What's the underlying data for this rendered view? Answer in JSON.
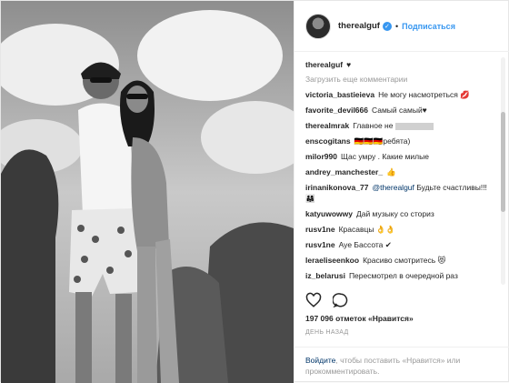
{
  "header": {
    "username": "therealguf",
    "verified_glyph": "✓",
    "separator": "•",
    "follow_label": "Подписаться"
  },
  "caption": {
    "username": "therealguf",
    "text": "♥"
  },
  "load_more": "Загрузить еще комментарии",
  "comments": [
    {
      "user": "victoria_bastieieva",
      "text": "Не могу насмотреться 💋"
    },
    {
      "user": "favorite_devil666",
      "text": "Самый самый♥"
    },
    {
      "user": "therealmrak",
      "text": "Главное не"
    },
    {
      "user": "enscogitans",
      "text": "🇩🇪🇩🇪🇩🇪ребята)"
    },
    {
      "user": "milor990",
      "text": "Щас умру . Какие милые"
    },
    {
      "user": "andrey_manchester_",
      "text": "👍"
    },
    {
      "user": "irinanikonova_77",
      "mention": "@therealguf",
      "text": "Будьте счастливы!!!👨‍👩‍👧"
    },
    {
      "user": "katyuwowwy",
      "text": "Дай музыку со сториз"
    },
    {
      "user": "rusv1ne",
      "text": "Красавцы 👌👌"
    },
    {
      "user": "rusv1ne",
      "text": "Ауе Бассота ✔"
    },
    {
      "user": "leraeliseenkoo",
      "text": "Красиво смотритесь 😻"
    },
    {
      "user": "iz_belarusi",
      "text": "Пересмотрел в очередной раз"
    }
  ],
  "likes": "197 096 отметок «Нравится»",
  "timestamp": "ДЕНЬ НАЗАД",
  "footer": {
    "login_link": "Войдите",
    "text_rest": ", чтобы поставить «Нравится» или прокомментировать."
  },
  "colors": {
    "accent": "#3897f0",
    "link": "#003569",
    "muted": "#999999"
  },
  "icons": [
    "heart-icon",
    "comment-icon",
    "verified-icon"
  ]
}
